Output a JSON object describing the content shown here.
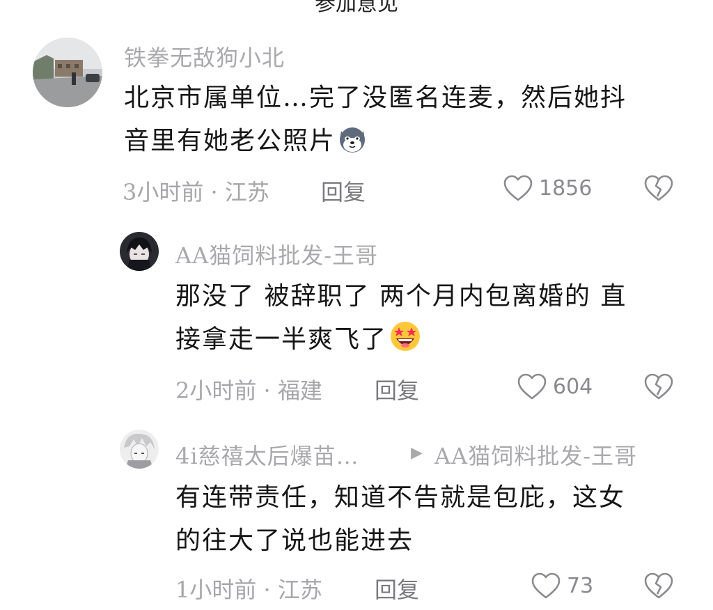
{
  "top_partial_text": "参加意见",
  "comments": [
    {
      "username": "铁拳无敌狗小北",
      "lines": [
        "北京市属单位…完了没匿名连麦，然后她抖",
        "音里有她老公照片"
      ],
      "emoji": "husky-dog-emoji",
      "meta": "3小时前 · 江苏",
      "reply_label": "回复",
      "likes": "1856"
    },
    {
      "username": "AA猫饲料批发-王哥",
      "lines": [
        "那没了 被辞职了 两个月内包离婚的 直",
        "接拿走一半爽飞了"
      ],
      "emoji": "star-struck-emoji",
      "meta": "2小时前 · 福建",
      "reply_label": "回复",
      "likes": "604"
    },
    {
      "username": "4i慈禧太后爆苗…",
      "reply_to": "AA猫饲料批发-王哥",
      "lines": [
        "有连带责任，知道不告就是包庇，这女",
        "的往大了说也能进去"
      ],
      "meta": "1小时前 · 江苏",
      "reply_label": "回复",
      "likes": "73"
    }
  ],
  "colors": {
    "text": "#161616",
    "muted": "#a9a9ad",
    "icon": "#8a8a8e"
  }
}
